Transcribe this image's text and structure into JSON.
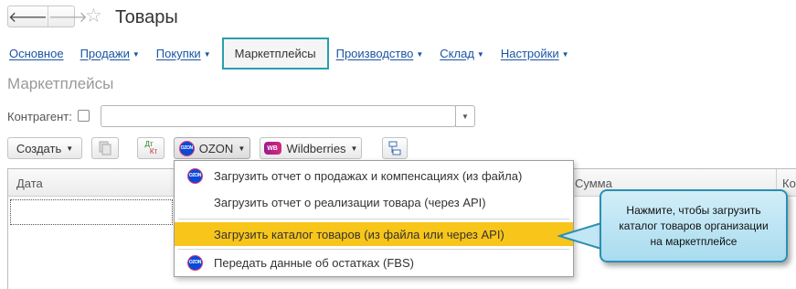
{
  "header": {
    "back_glyph": "🡐",
    "forward_glyph": "🡒",
    "title": "Товары"
  },
  "sections": [
    {
      "label": "Основное"
    },
    {
      "label": "Продажи"
    },
    {
      "label": "Покупки"
    },
    {
      "label": "Маркетплейсы",
      "active": true
    },
    {
      "label": "Производство"
    },
    {
      "label": "Склад"
    },
    {
      "label": "Настройки"
    }
  ],
  "page": {
    "subtitle": "Маркетплейсы",
    "counterparty_label": "Контрагент:",
    "counterparty_value": ""
  },
  "toolbar": {
    "create_label": "Создать",
    "dtkt_top": "Дт",
    "dtkt_bottom": "Кт",
    "ozon_label": "OZON",
    "wildberries_label": "Wildberries"
  },
  "table": {
    "columns": [
      "Дата",
      "Сумма",
      "Ко"
    ]
  },
  "menu": {
    "items": [
      {
        "label": "Загрузить отчет о продажах и компенсациях (из файла)",
        "icon": "ozon-icon"
      },
      {
        "label": "Загрузить отчет о реализации товара  (через API)",
        "icon": "none"
      },
      {
        "label": "Загрузить каталог товаров (из файла или через API)",
        "icon": "none",
        "highlighted": true
      },
      {
        "label": "Передать данные об остатках (FBS)",
        "icon": "ozon-icon"
      }
    ]
  },
  "callout": {
    "text": "Нажмите, чтобы загрузить\nкаталог товаров организации\nна маркетплейсе"
  },
  "logos": {
    "ozon": "OZON",
    "wb": "WB"
  },
  "colors": {
    "link": "#1a55a5",
    "active_tab_border": "#27a0ae",
    "menu_highlight": "#f8c51a",
    "callout_border": "#2b8fb3",
    "ozon_blue": "#0a4ad6"
  }
}
